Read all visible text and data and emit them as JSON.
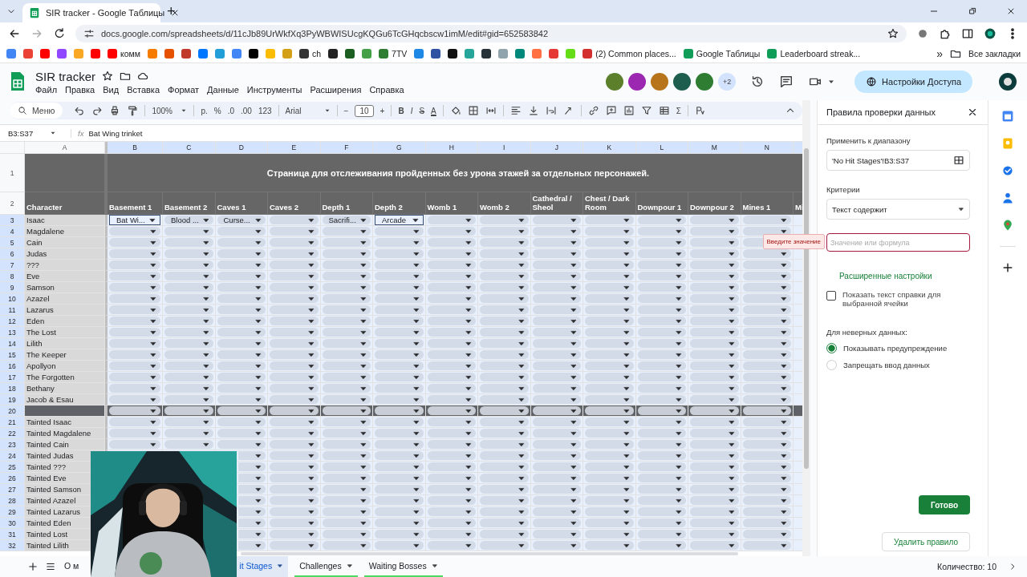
{
  "browser": {
    "tab_title": "SIR tracker - Google Таблицы",
    "new_tab": "+",
    "url": "docs.google.com/spreadsheets/d/11cJb89UrWkfXq3PyWBWISUcgKQGu6TcGHqcbscw1imM/edit#gid=652583842",
    "bookmarks": [
      {
        "color": "#4285f4"
      },
      {
        "color": "#ea4335"
      },
      {
        "color": "#ff0000"
      },
      {
        "color": "#9146ff"
      },
      {
        "color": "#f9a825"
      },
      {
        "color": "#ff0000"
      },
      {
        "color": "#ff0000",
        "label": "комм"
      },
      {
        "color": "#f57c00"
      },
      {
        "color": "#e65100"
      },
      {
        "color": "#c0392b"
      },
      {
        "color": "#0077ff"
      },
      {
        "color": "#229ed9"
      },
      {
        "color": "#4285f4"
      },
      {
        "color": "#000000"
      },
      {
        "color": "#fbbc04"
      },
      {
        "color": "#d4a017"
      },
      {
        "color": "#333333",
        "label": "ch"
      },
      {
        "color": "#222222"
      },
      {
        "color": "#1b5e20"
      },
      {
        "color": "#43a047"
      },
      {
        "color": "#2e7d32",
        "label": "7TV"
      },
      {
        "color": "#1e88e5"
      },
      {
        "color": "#2e51a2"
      },
      {
        "color": "#111111"
      },
      {
        "color": "#26a69a"
      },
      {
        "color": "#263238"
      },
      {
        "color": "#90a4ae"
      },
      {
        "color": "#00897b"
      },
      {
        "color": "#ff7043"
      },
      {
        "color": "#e53935"
      },
      {
        "color": "#64dd17"
      },
      {
        "color": "#d32f2f",
        "label": "(2) Common places..."
      },
      {
        "color": "#0f9d58",
        "label": "Google Таблицы"
      },
      {
        "color": "#0f9d58",
        "label": "Leaderboard streak..."
      }
    ],
    "more": "»",
    "all_bookmarks": "Все закладки"
  },
  "doc": {
    "title": "SIR tracker",
    "menus": [
      "Файл",
      "Правка",
      "Вид",
      "Вставка",
      "Формат",
      "Данные",
      "Инструменты",
      "Расширения",
      "Справка"
    ],
    "collaborators": [
      {
        "color": "#5b7f2b"
      },
      {
        "color": "#9c27b0"
      },
      {
        "color": "#b8741a"
      },
      {
        "color": "#1e5e4e"
      },
      {
        "color": "#2e7d32"
      }
    ],
    "more_collaborators": "+2",
    "share": "Настройки Доступа"
  },
  "toolbar": {
    "menu_search": "Меню",
    "zoom": "100%",
    "currency": "р.",
    "percent": "%",
    "dec_less": ".0",
    "dec_more": ".00",
    "format_123": "123",
    "font": "Arial",
    "minus": "−",
    "font_size": "10",
    "plus": "+",
    "bold": "B",
    "italic": "I",
    "strike": "S",
    "text_color": "A",
    "sigma": "Σ"
  },
  "formula_bar": {
    "range": "B3:S37",
    "fx": "fx",
    "value": "Bat Wing trinket"
  },
  "sheet": {
    "title": "Страница для отслеживания пройденных без урона этажей за отдельных персонажей.",
    "columns": [
      {
        "letter": "A",
        "heading": "Character"
      },
      {
        "letter": "B",
        "heading": "Basement 1"
      },
      {
        "letter": "C",
        "heading": "Basement 2"
      },
      {
        "letter": "D",
        "heading": "Caves 1"
      },
      {
        "letter": "E",
        "heading": "Caves 2"
      },
      {
        "letter": "F",
        "heading": "Depth 1"
      },
      {
        "letter": "G",
        "heading": "Depth 2"
      },
      {
        "letter": "H",
        "heading": "Womb 1"
      },
      {
        "letter": "I",
        "heading": "Womb 2"
      },
      {
        "letter": "J",
        "heading": "Cathedral / Sheol"
      },
      {
        "letter": "K",
        "heading": "Chest / Dark Room"
      },
      {
        "letter": "L",
        "heading": "Downpour 1"
      },
      {
        "letter": "M",
        "heading": "Downpour 2"
      },
      {
        "letter": "N",
        "heading": "Mines 1"
      },
      {
        "heading": "Mi"
      }
    ],
    "title_row_number": "1",
    "heading_row_number": "2",
    "rows": [
      {
        "number": "3",
        "kind": "character",
        "name": "Isaac",
        "cells": [
          {
            "text": "Bat Wi...",
            "selected": true
          },
          {
            "text": "Blood ...",
            "selected": false
          },
          {
            "text": "Curse...",
            "selected": false
          },
          {
            "selected": false
          },
          {
            "text": "Sacrifi...",
            "selected": false
          },
          {
            "text": "Arcade",
            "selected": true
          },
          {
            "selected": false
          },
          {
            "selected": false
          },
          {
            "selected": false
          },
          {
            "selected": false
          },
          {
            "selected": false
          },
          {
            "selected": false
          },
          {
            "selected": false
          }
        ]
      },
      {
        "number": "4",
        "kind": "character",
        "name": "Magdalene"
      },
      {
        "number": "5",
        "kind": "character",
        "name": "Cain"
      },
      {
        "number": "6",
        "kind": "character",
        "name": "Judas"
      },
      {
        "number": "7",
        "kind": "character",
        "name": "???"
      },
      {
        "number": "8",
        "kind": "character",
        "name": "Eve"
      },
      {
        "number": "9",
        "kind": "character",
        "name": "Samson"
      },
      {
        "number": "10",
        "kind": "character",
        "name": "Azazel"
      },
      {
        "number": "11",
        "kind": "character",
        "name": "Lazarus"
      },
      {
        "number": "12",
        "kind": "character",
        "name": "Eden"
      },
      {
        "number": "13",
        "kind": "character",
        "name": "The Lost"
      },
      {
        "number": "14",
        "kind": "character",
        "name": "Lilith"
      },
      {
        "number": "15",
        "kind": "character",
        "name": "The Keeper"
      },
      {
        "number": "16",
        "kind": "character",
        "name": "Apollyon"
      },
      {
        "number": "17",
        "kind": "character",
        "name": "The Forgotten"
      },
      {
        "number": "18",
        "kind": "character",
        "name": "Bethany"
      },
      {
        "number": "19",
        "kind": "character",
        "name": "Jacob & Esau"
      },
      {
        "number": "20",
        "kind": "separator"
      },
      {
        "number": "21",
        "kind": "character",
        "name": "Tainted Isaac"
      },
      {
        "number": "22",
        "kind": "character",
        "name": "Tainted Magdalene"
      },
      {
        "number": "23",
        "kind": "character",
        "name": "Tainted Cain"
      },
      {
        "number": "24",
        "kind": "character",
        "name": "Tainted Judas"
      },
      {
        "number": "25",
        "kind": "character",
        "name": "Tainted ???"
      },
      {
        "number": "26",
        "kind": "character",
        "name": "Tainted Eve"
      },
      {
        "number": "27",
        "kind": "character",
        "name": "Tainted Samson"
      },
      {
        "number": "28",
        "kind": "character",
        "name": "Tainted Azazel"
      },
      {
        "number": "29",
        "kind": "character",
        "name": "Tainted Lazarus"
      },
      {
        "number": "30",
        "kind": "character",
        "name": "Tainted Eden"
      },
      {
        "number": "31",
        "kind": "character",
        "name": "Tainted Lost"
      },
      {
        "number": "32",
        "kind": "character",
        "name": "Tainted Lilith"
      }
    ]
  },
  "panel": {
    "title": "Правила проверки данных",
    "range_label": "Применить к диапазону",
    "range_value": "'No Hit Stages'!B3:S37",
    "criteria_label": "Критерии",
    "criteria_value": "Текст содержит",
    "value_placeholder": "Значение или формула",
    "error_tip": "Введите значение",
    "advanced": "Расширенные настройки",
    "help_checkbox": {
      "label": "Показать текст справки для выбранной ячейки",
      "checked": false
    },
    "invalid_label": "Для неверных данных:",
    "invalid_options": [
      {
        "label": "Показывать предупреждение",
        "selected": true
      },
      {
        "label": "Запрещать ввод данных",
        "selected": false
      }
    ],
    "done": "Готово",
    "delete": "Удалить правило"
  },
  "sheet_tabs": [
    {
      "label": "О м",
      "selected": false
    },
    {
      "label": "it Stages",
      "selected": true
    },
    {
      "label": "Challenges",
      "selected": false,
      "color": "#4cd964"
    },
    {
      "label": "Waiting Bosses",
      "selected": false,
      "color": "#4cd964"
    }
  ],
  "status": "Количество: 10"
}
